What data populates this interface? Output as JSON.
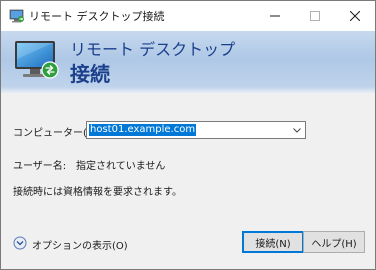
{
  "window": {
    "title": "リモート デスクトップ接続"
  },
  "banner": {
    "line1": "リモート デスクトップ",
    "line2": "接続"
  },
  "form": {
    "computer_label": "コンピューター(C):",
    "computer_value": "host01.example.com",
    "user_label": "ユーザー名:",
    "user_value": "指定されていません",
    "credential_note": "接続時には資格情報を要求されます。"
  },
  "footer": {
    "options_label": "オプションの表示(O)",
    "connect_label": "接続(N)",
    "help_label": "ヘルプ(H)"
  },
  "icons": {
    "app": "remote-desktop-icon",
    "minimize": "minimize-icon",
    "maximize": "maximize-icon",
    "close": "close-icon",
    "banner": "remote-desktop-monitor-icon",
    "dropdown": "chevron-down-icon",
    "options": "chevron-down-circle-icon"
  },
  "colors": {
    "accent": "#0078d7",
    "banner_text": "#1b3f8b"
  }
}
